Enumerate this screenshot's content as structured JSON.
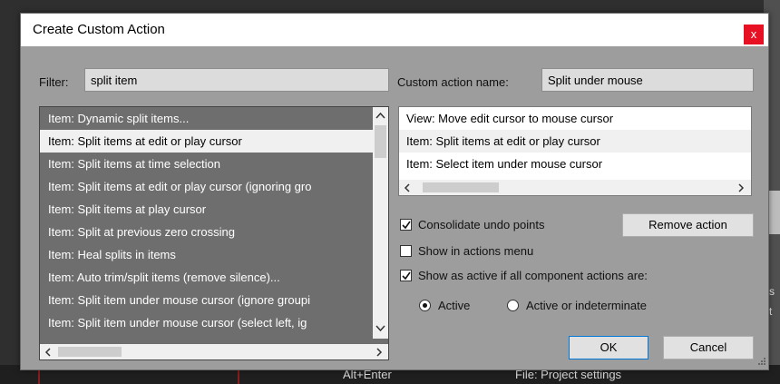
{
  "dialog": {
    "title": "Create Custom Action",
    "close_glyph": "x"
  },
  "filter": {
    "label": "Filter:",
    "value": "split item"
  },
  "name": {
    "label": "Custom action name:",
    "value": "Split under mouse"
  },
  "action_list": {
    "items": [
      "Item: Dynamic split items...",
      "Item: Split items at edit or play cursor",
      "Item: Split items at time selection",
      "Item: Split items at edit or play cursor (ignoring gro",
      "Item: Split items at play cursor",
      "Item: Split at previous zero crossing",
      "Item: Heal splits in items",
      "Item: Auto trim/split items (remove silence)...",
      "Item: Split item under mouse cursor (ignore groupi",
      "Item: Split item under mouse cursor (select left, ig"
    ],
    "selected_index": 1
  },
  "custom_list": {
    "items": [
      "View: Move edit cursor to mouse cursor",
      "Item: Split items at edit or play cursor",
      "Item: Select item under mouse cursor"
    ],
    "selected_index": 1
  },
  "options": {
    "consolidate": {
      "label": "Consolidate undo points",
      "checked": true
    },
    "show_in_menu": {
      "label": "Show in actions menu",
      "checked": false
    },
    "show_active": {
      "label": "Show as active if all component actions are:",
      "checked": true
    },
    "radio_active": {
      "label": "Active",
      "selected": true
    },
    "radio_indeterminate": {
      "label": "Active or indeterminate",
      "selected": false
    }
  },
  "buttons": {
    "remove": "Remove action",
    "ok": "OK",
    "cancel": "Cancel"
  },
  "background": {
    "shortcut": "Alt+Enter",
    "action": "File: Project settings",
    "right_1": "s",
    "right_2": "t"
  },
  "colors": {
    "close": "#e81123",
    "default_border": "#0078d7",
    "list_bg": "#6e6e6e",
    "dialog_bg": "#9d9d9d"
  },
  "icons": {
    "up": "chevron-up-icon",
    "down": "chevron-down-icon",
    "left": "chevron-left-icon",
    "right": "chevron-right-icon",
    "check": "check-icon"
  }
}
